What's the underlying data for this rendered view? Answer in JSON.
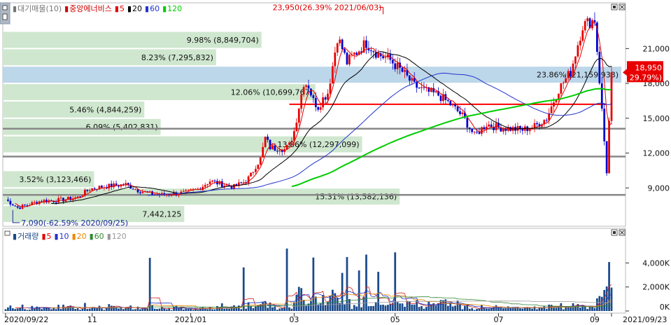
{
  "colors": {
    "up": "#e60000",
    "down": "#0000cc",
    "ma5": "#e60000",
    "ma20": "#000000",
    "ma60": "#2233cc",
    "ma120": "#00cc00",
    "profile": "#cfe7cf",
    "profile_hi": "#bcd6ea",
    "hline": "#888888",
    "redline": "#ff0000",
    "vol": "#1a4a8a",
    "vma5": "#cc2222",
    "vma10": "#2233cc",
    "vma20": "#ee8800",
    "vma60": "#338833",
    "vma120": "#999999"
  },
  "legend": {
    "price": [
      {
        "text": "대기매물(10)",
        "color": "#777777"
      },
      {
        "text": "중앙에너비스",
        "color": "#cc0000"
      },
      {
        "text": "5",
        "color": "#e60000"
      },
      {
        "text": "20",
        "color": "#000000"
      },
      {
        "text": "60",
        "color": "#2233cc"
      },
      {
        "text": "120",
        "color": "#00cc00"
      }
    ],
    "volume": [
      {
        "text": "거래량",
        "color": "#1a4a8a"
      },
      {
        "text": "5",
        "color": "#e60000"
      },
      {
        "text": "10",
        "color": "#2233cc"
      },
      {
        "text": "20",
        "color": "#ee8800"
      },
      {
        "text": "60",
        "color": "#338833"
      },
      {
        "text": "120",
        "color": "#999999"
      }
    ]
  },
  "chart_data": {
    "type": "candlestick",
    "price_axis": {
      "ticks": [
        9000,
        12000,
        15000,
        18000,
        21000
      ],
      "labels": [
        "9,000",
        "12,000",
        "15,000",
        "18,000",
        "21,000"
      ],
      "ylim": [
        6000,
        24700
      ]
    },
    "volume_axis": {
      "ticks": [
        0,
        2000000,
        4000000
      ],
      "labels": [
        "0K",
        "2,000K",
        "4,000K"
      ]
    },
    "x_axis": {
      "labels": [
        "2020/09/22",
        "11",
        "2021/01",
        "03",
        "05",
        "07",
        "09",
        "2021/09/23"
      ]
    },
    "price_series": {
      "day": [
        0,
        5,
        10,
        15,
        20,
        25,
        30,
        35,
        40,
        45,
        50,
        55,
        60,
        65,
        70,
        75,
        80,
        85,
        90,
        95,
        100,
        102,
        104,
        106,
        108,
        110,
        112,
        114,
        116,
        118,
        120,
        122,
        124,
        126,
        128,
        130,
        132,
        134,
        136,
        138,
        140,
        142,
        145,
        150,
        155,
        160,
        165,
        170,
        175,
        180,
        185,
        190,
        195,
        200,
        205,
        210,
        215,
        220,
        225,
        230,
        235,
        240,
        245,
        250,
        252
      ],
      "close": [
        8000,
        7300,
        7600,
        7900,
        7900,
        8000,
        8200,
        8900,
        9100,
        9200,
        9300,
        8800,
        8500,
        8400,
        8500,
        8600,
        8900,
        9600,
        9300,
        9100,
        9600,
        10100,
        10900,
        11500,
        13300,
        12500,
        12400,
        12500,
        12300,
        12700,
        13900,
        16000,
        18100,
        17800,
        16500,
        16000,
        16700,
        17200,
        19500,
        22000,
        21000,
        19800,
        20500,
        21500,
        20500,
        20000,
        19000,
        17800,
        17300,
        17000,
        16200,
        15200,
        13500,
        14500,
        14200,
        14100,
        14000,
        14300,
        15000,
        17500,
        19000,
        23000,
        23500,
        10400,
        18950
      ]
    },
    "volume_profile": [
      {
        "label": "3.52% (3,123,466)",
        "low": 9000,
        "high": 10500
      },
      {
        "label": "5.46% (4,844,259)",
        "low": 15000,
        "high": 16500
      },
      {
        "label": "6.09% (5,402,831)",
        "low": 13500,
        "high": 15000
      },
      {
        "label": "8.23% (7,295,832)",
        "low": 19500,
        "high": 21000
      },
      {
        "label": "9.98% (8,849,704)",
        "low": 21000,
        "high": 22500
      },
      {
        "label": "12.06% (10,699,767)",
        "low": 16500,
        "high": 18000
      },
      {
        "label": "13.86% (12,297,099)",
        "low": 12000,
        "high": 13500
      },
      {
        "label": "15.31% (13,582,136)",
        "low": 7500,
        "high": 9000
      },
      {
        "label": "23.86% (21,159,933)",
        "low": 18000,
        "high": 19500
      },
      {
        "label": "7,442,125",
        "low": 6000,
        "high": 7500
      }
    ],
    "hlines": [
      8400,
      11700,
      14100
    ],
    "red_hline": 16200,
    "annotations": {
      "high_label": "23,950(26.39% 2021/06/03)",
      "high_value": 23950,
      "high_day": 157,
      "low_label": "7,090(-62.59% 2020/09/25)",
      "low_value": 7090,
      "low_day": 3,
      "current_price": "18,950",
      "current_change": "( 29.79%)",
      "current_value": 18950
    }
  }
}
